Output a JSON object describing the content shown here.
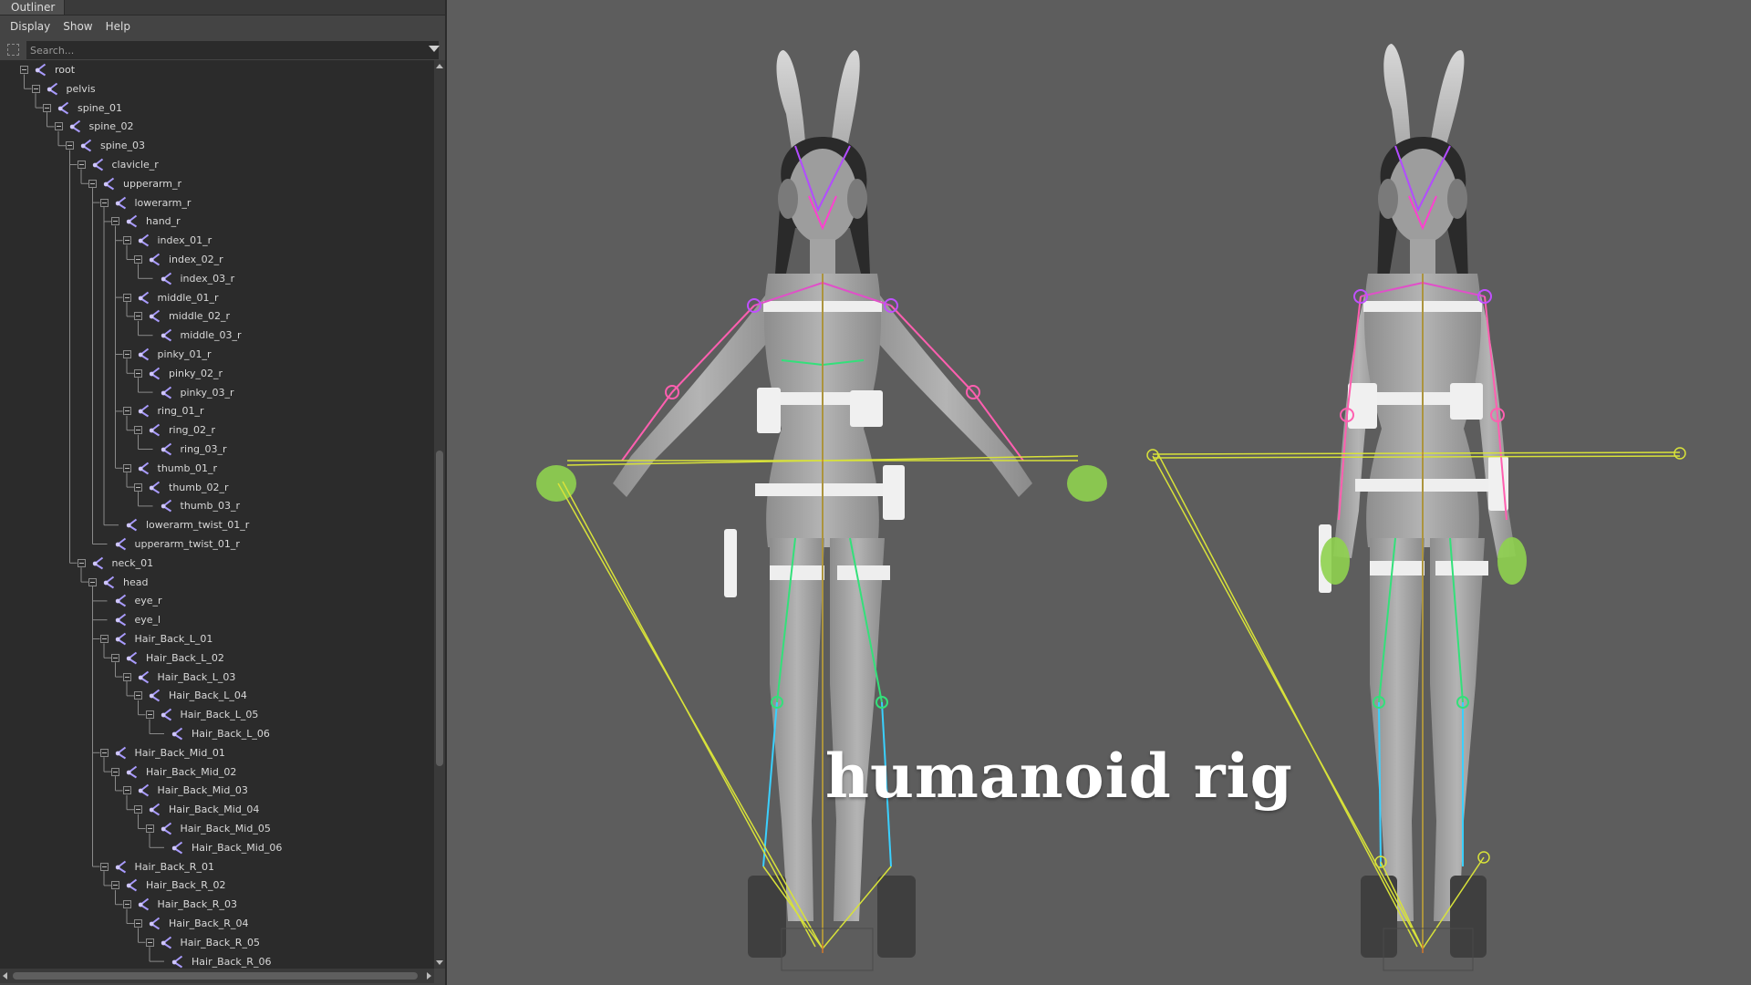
{
  "panel": {
    "title": "Outliner",
    "menu": [
      "Display",
      "Show",
      "Help"
    ],
    "search_placeholder": "Search..."
  },
  "tree": [
    {
      "label": "root",
      "depth": 0,
      "expandable": true
    },
    {
      "label": "pelvis",
      "depth": 1,
      "expandable": true
    },
    {
      "label": "spine_01",
      "depth": 2,
      "expandable": true
    },
    {
      "label": "spine_02",
      "depth": 3,
      "expandable": true
    },
    {
      "label": "spine_03",
      "depth": 4,
      "expandable": true
    },
    {
      "label": "clavicle_r",
      "depth": 5,
      "expandable": true
    },
    {
      "label": "upperarm_r",
      "depth": 6,
      "expandable": true
    },
    {
      "label": "lowerarm_r",
      "depth": 7,
      "expandable": true
    },
    {
      "label": "hand_r",
      "depth": 8,
      "expandable": true
    },
    {
      "label": "index_01_r",
      "depth": 9,
      "expandable": true
    },
    {
      "label": "index_02_r",
      "depth": 10,
      "expandable": true
    },
    {
      "label": "index_03_r",
      "depth": 11,
      "expandable": false
    },
    {
      "label": "middle_01_r",
      "depth": 9,
      "expandable": true
    },
    {
      "label": "middle_02_r",
      "depth": 10,
      "expandable": true
    },
    {
      "label": "middle_03_r",
      "depth": 11,
      "expandable": false
    },
    {
      "label": "pinky_01_r",
      "depth": 9,
      "expandable": true
    },
    {
      "label": "pinky_02_r",
      "depth": 10,
      "expandable": true
    },
    {
      "label": "pinky_03_r",
      "depth": 11,
      "expandable": false
    },
    {
      "label": "ring_01_r",
      "depth": 9,
      "expandable": true
    },
    {
      "label": "ring_02_r",
      "depth": 10,
      "expandable": true
    },
    {
      "label": "ring_03_r",
      "depth": 11,
      "expandable": false
    },
    {
      "label": "thumb_01_r",
      "depth": 9,
      "expandable": true
    },
    {
      "label": "thumb_02_r",
      "depth": 10,
      "expandable": true
    },
    {
      "label": "thumb_03_r",
      "depth": 11,
      "expandable": false
    },
    {
      "label": "lowerarm_twist_01_r",
      "depth": 8,
      "expandable": false
    },
    {
      "label": "upperarm_twist_01_r",
      "depth": 7,
      "expandable": false
    },
    {
      "label": "neck_01",
      "depth": 5,
      "expandable": true
    },
    {
      "label": "head",
      "depth": 6,
      "expandable": true
    },
    {
      "label": "eye_r",
      "depth": 7,
      "expandable": false
    },
    {
      "label": "eye_l",
      "depth": 7,
      "expandable": false
    },
    {
      "label": "Hair_Back_L_01",
      "depth": 7,
      "expandable": true
    },
    {
      "label": "Hair_Back_L_02",
      "depth": 8,
      "expandable": true
    },
    {
      "label": "Hair_Back_L_03",
      "depth": 9,
      "expandable": true
    },
    {
      "label": "Hair_Back_L_04",
      "depth": 10,
      "expandable": true
    },
    {
      "label": "Hair_Back_L_05",
      "depth": 11,
      "expandable": true
    },
    {
      "label": "Hair_Back_L_06",
      "depth": 12,
      "expandable": false
    },
    {
      "label": "Hair_Back_Mid_01",
      "depth": 7,
      "expandable": true
    },
    {
      "label": "Hair_Back_Mid_02",
      "depth": 8,
      "expandable": true
    },
    {
      "label": "Hair_Back_Mid_03",
      "depth": 9,
      "expandable": true
    },
    {
      "label": "Hair_Back_Mid_04",
      "depth": 10,
      "expandable": true
    },
    {
      "label": "Hair_Back_Mid_05",
      "depth": 11,
      "expandable": true
    },
    {
      "label": "Hair_Back_Mid_06",
      "depth": 12,
      "expandable": false
    },
    {
      "label": "Hair_Back_R_01",
      "depth": 7,
      "expandable": true
    },
    {
      "label": "Hair_Back_R_02",
      "depth": 8,
      "expandable": true
    },
    {
      "label": "Hair_Back_R_03",
      "depth": 9,
      "expandable": true
    },
    {
      "label": "Hair_Back_R_04",
      "depth": 10,
      "expandable": true
    },
    {
      "label": "Hair_Back_R_05",
      "depth": 11,
      "expandable": true
    },
    {
      "label": "Hair_Back_R_06",
      "depth": 12,
      "expandable": false
    }
  ],
  "viewport": {
    "overlay_title": "humanoid rig",
    "figures": [
      "a-pose",
      "rest-pose"
    ]
  },
  "icons": {
    "joint": "joint-icon",
    "select": "select-icon",
    "dropdown": "chevron-down-icon"
  },
  "colors": {
    "panel_bg": "#444444",
    "tree_bg": "#2b2b2b",
    "viewport_bg": "#5d5d5d",
    "joint_icon": "#9a8cff",
    "bone_spine": "#33e07a",
    "bone_arm": "#ff5fb0",
    "bone_leg": "#3ad0ff",
    "ik_handle": "#d8e23a"
  }
}
